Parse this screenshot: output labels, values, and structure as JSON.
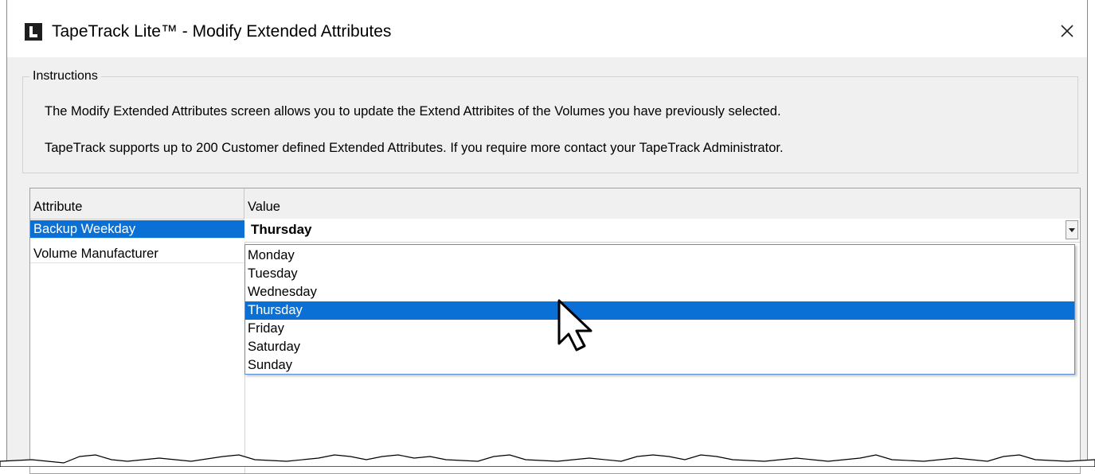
{
  "window": {
    "title": "TapeTrack Lite™ - Modify Extended Attributes",
    "close_glyph": "✕"
  },
  "instructions": {
    "legend": "Instructions",
    "line1": "The Modify Extended Attributes screen allows you to update the Extend Attribites of the Volumes you have previously selected.",
    "line2": "TapeTrack supports up to 200 Customer defined Extended Attributes. If you require more contact your TapeTrack Administrator."
  },
  "grid": {
    "headers": {
      "attribute": "Attribute",
      "value": "Value"
    },
    "rows": [
      {
        "attribute": "Backup Weekday",
        "selected": true
      },
      {
        "attribute": "Volume Manufacturer",
        "selected": false
      }
    ]
  },
  "combo": {
    "current_value": "Thursday",
    "options": [
      "Monday",
      "Tuesday",
      "Wednesday",
      "Thursday",
      "Friday",
      "Saturday",
      "Sunday"
    ],
    "highlighted_option": "Thursday"
  },
  "colors": {
    "selection": "#0a70d6",
    "window_bg": "#f0f0f0"
  },
  "icons": {
    "app": "tapetrack-app-icon",
    "close": "close-icon",
    "dropdown": "chevron-down-icon",
    "cursor": "mouse-pointer-icon"
  }
}
